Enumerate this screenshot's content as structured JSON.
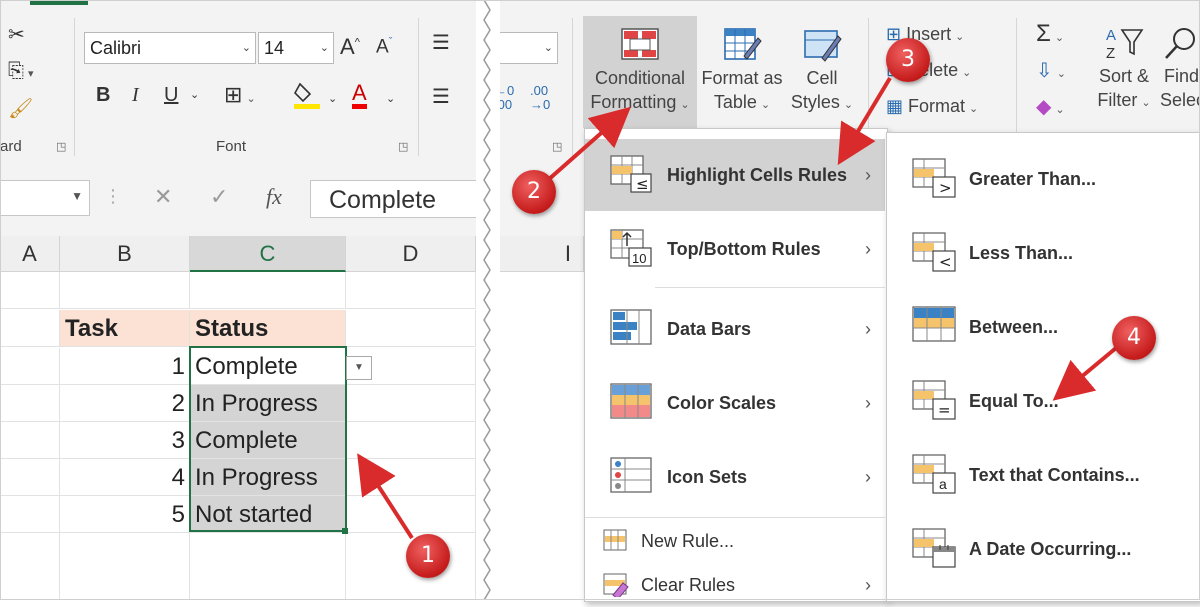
{
  "ribbon": {
    "font_group_label": "Font",
    "clipboard_group_label": "ard",
    "font_name": "Calibri",
    "font_size": "14",
    "bold_label": "B",
    "italic_label": "I",
    "underline_label": "U",
    "grow_font_label": "A",
    "shrink_font_label": "A",
    "font_color_label": "A",
    "conditional_formatting": {
      "line1": "Conditional",
      "line2": "Formatting"
    },
    "format_as_table": {
      "line1": "Format as",
      "line2": "Table"
    },
    "cell_styles": {
      "line1": "Cell",
      "line2": "Styles"
    },
    "insert_label": "Insert",
    "delete_label": "Delete",
    "format_label": "Format",
    "sort_filter": {
      "line1": "Sort &",
      "line2": "Filter"
    },
    "find_select": {
      "line1": "Find",
      "line2": "Selec"
    },
    "sigma_label": "Σ",
    "accent_color": "#217346"
  },
  "formula_bar": {
    "fx_label": "fx",
    "value": "Complete"
  },
  "grid": {
    "columns": [
      "A",
      "B",
      "C",
      "D",
      "I"
    ],
    "header_row": {
      "task": "Task",
      "status": "Status"
    },
    "rows": [
      {
        "num": "1",
        "status": "Complete"
      },
      {
        "num": "2",
        "status": "In Progress"
      },
      {
        "num": "3",
        "status": "Complete"
      },
      {
        "num": "4",
        "status": "In Progress"
      },
      {
        "num": "5",
        "status": "Not started"
      }
    ],
    "header_fill": "#fbe2d5",
    "selection_fill": "#d4d4d4"
  },
  "cf_menu": {
    "items": [
      {
        "label": "Highlight Cells Rules",
        "icon": "highlight-cells-icon"
      },
      {
        "label": "Top/Bottom Rules",
        "icon": "top-bottom-icon"
      },
      {
        "label": "Data Bars",
        "icon": "data-bars-icon"
      },
      {
        "label": "Color Scales",
        "icon": "color-scales-icon"
      },
      {
        "label": "Icon Sets",
        "icon": "icon-sets-icon"
      }
    ],
    "small_items": [
      {
        "label": "New Rule...",
        "icon": "new-rule-icon"
      },
      {
        "label": "Clear Rules",
        "icon": "clear-rules-icon"
      }
    ]
  },
  "highlight_submenu": {
    "items": [
      {
        "label": "Greater Than...",
        "icon": "greater-than-icon"
      },
      {
        "label": "Less Than...",
        "icon": "less-than-icon"
      },
      {
        "label": "Between...",
        "icon": "between-icon"
      },
      {
        "label": "Equal To...",
        "icon": "equal-to-icon"
      },
      {
        "label": "Text that Contains...",
        "icon": "text-contains-icon"
      },
      {
        "label": "A Date Occurring...",
        "icon": "date-occurring-icon"
      }
    ]
  },
  "annotations": {
    "badges": [
      "1",
      "2",
      "3",
      "4"
    ],
    "color": "#d92b2b"
  }
}
